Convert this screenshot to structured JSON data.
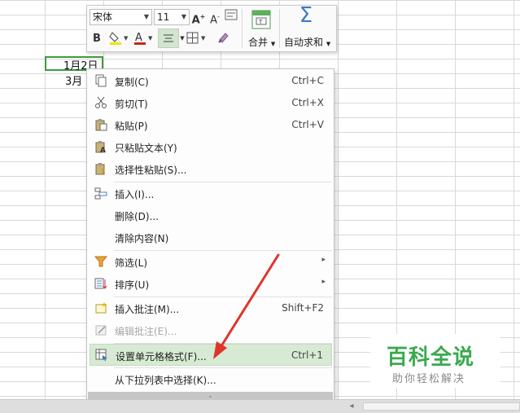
{
  "sheet": {
    "cells": [
      "1月2日",
      "3月"
    ]
  },
  "mini_toolbar": {
    "font_name": "宋体",
    "font_size": "11",
    "merge_label": "合并",
    "autosum_label": "自动求和"
  },
  "context_menu": {
    "items": [
      {
        "label": "复制(C)",
        "shortcut": "Ctrl+C",
        "icon": "copy-icon"
      },
      {
        "label": "剪切(T)",
        "shortcut": "Ctrl+X",
        "icon": "cut-icon"
      },
      {
        "label": "粘贴(P)",
        "shortcut": "Ctrl+V",
        "icon": "paste-icon"
      },
      {
        "label": "只粘贴文本(Y)",
        "shortcut": "",
        "icon": "paste-text-icon"
      },
      {
        "label": "选择性粘贴(S)...",
        "shortcut": "",
        "icon": "paste-special-icon"
      },
      {
        "label": "插入(I)...",
        "shortcut": "",
        "icon": "insert-icon"
      },
      {
        "label": "删除(D)...",
        "shortcut": "",
        "icon": ""
      },
      {
        "label": "清除内容(N)",
        "shortcut": "",
        "icon": ""
      },
      {
        "label": "筛选(L)",
        "shortcut": "",
        "icon": "filter-icon",
        "submenu": true
      },
      {
        "label": "排序(U)",
        "shortcut": "",
        "icon": "sort-icon",
        "submenu": true
      },
      {
        "label": "插入批注(M)...",
        "shortcut": "Shift+F2",
        "icon": "insert-comment-icon"
      },
      {
        "label": "编辑批注(E)...",
        "shortcut": "",
        "icon": "edit-comment-icon",
        "disabled": true
      },
      {
        "label": "设置单元格格式(F)...",
        "shortcut": "Ctrl+1",
        "icon": "format-cells-icon",
        "highlighted": true
      },
      {
        "label": "从下拉列表中选择(K)...",
        "shortcut": "",
        "icon": ""
      }
    ]
  },
  "watermark": {
    "title": "百科全说",
    "subtitle": "助你轻松解决"
  },
  "colors": {
    "accent_green": "#3aa94e",
    "highlight": "#d7ead3",
    "annotation_red": "#e0342b"
  }
}
